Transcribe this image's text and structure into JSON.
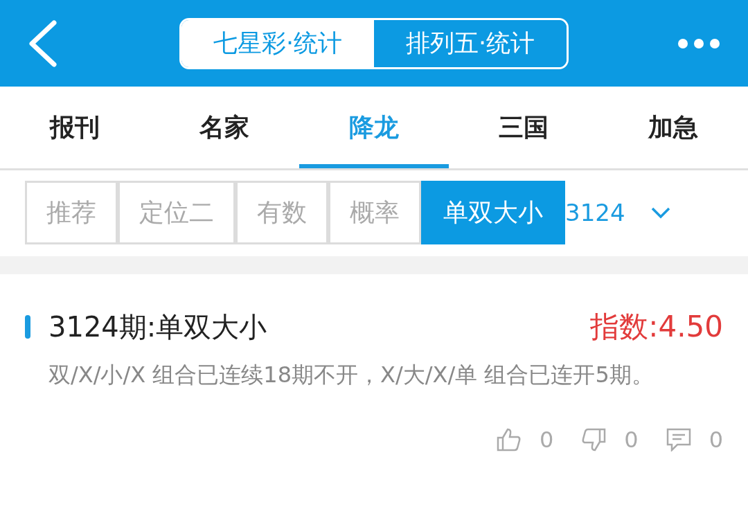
{
  "header": {
    "switch": [
      {
        "label": "七星彩·统计",
        "selected": true
      },
      {
        "label": "排列五·统计",
        "selected": false
      }
    ]
  },
  "tabs": [
    {
      "label": "报刊",
      "selected": false
    },
    {
      "label": "名家",
      "selected": false
    },
    {
      "label": "降龙",
      "selected": true
    },
    {
      "label": "三国",
      "selected": false
    },
    {
      "label": "加急",
      "selected": false
    }
  ],
  "sub_tabs": [
    {
      "label": "推荐",
      "selected": false
    },
    {
      "label": "定位二",
      "selected": false
    },
    {
      "label": "有数",
      "selected": false
    },
    {
      "label": "概率",
      "selected": false
    },
    {
      "label": "单双大小",
      "selected": true
    }
  ],
  "period_picker": {
    "value": "3124"
  },
  "card": {
    "title": "3124期:单双大小",
    "index": "指数:4.50",
    "description": "双/X/小/X 组合已连续18期不开，X/大/X/单 组合已连开5期。",
    "likes": "0",
    "dislikes": "0",
    "comments": "0"
  }
}
